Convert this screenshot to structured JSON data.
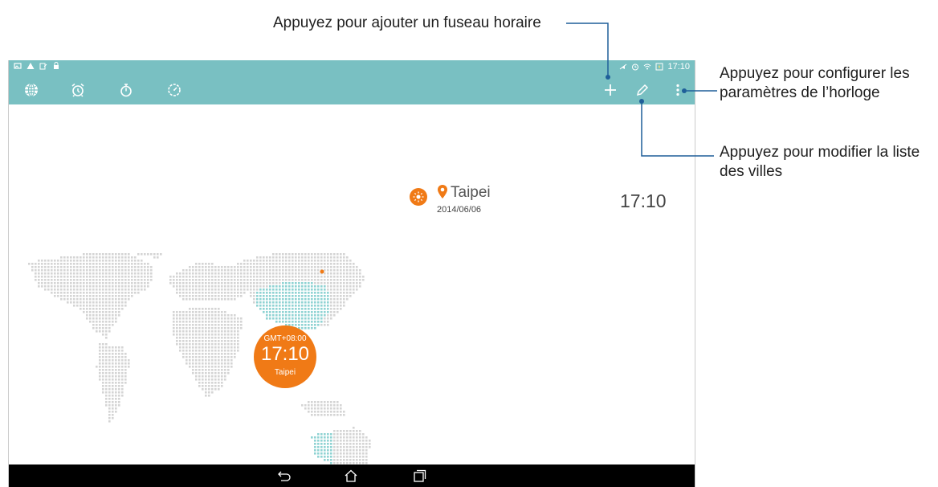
{
  "callouts": {
    "add_timezone": "Appuyez pour ajouter un fuseau horaire",
    "settings_line1": "Appuyez pour configurer les",
    "settings_line2": "paramètres de l’horloge",
    "edit_line1": "Appuyez pour modifier la liste",
    "edit_line2": "des villes"
  },
  "statusbar": {
    "time": "17:10",
    "left_icons": [
      "image-icon",
      "warning-icon",
      "signal-edit-icon",
      "lock-icon"
    ],
    "right_icons": [
      "mute-icon",
      "alarm-icon",
      "wifi-icon",
      "battery-charging-icon"
    ]
  },
  "actionbar": {
    "tabs": [
      "world-clock-icon",
      "alarm-icon",
      "stopwatch-icon",
      "timer-icon"
    ],
    "actions": [
      "add-icon",
      "edit-icon",
      "overflow-menu-icon"
    ]
  },
  "city": {
    "name": "Taipei",
    "date": "2014/06/06",
    "time": "17:10"
  },
  "map_bubble": {
    "gmt": "GMT+08:00",
    "time": "17:10",
    "city": "Taipei"
  },
  "navbar": {
    "buttons": [
      "back-icon",
      "home-icon",
      "recents-icon"
    ]
  },
  "colors": {
    "teal": "#79c0c2",
    "orange": "#f07a16",
    "map_gray": "#d4d4d4",
    "map_highlight": "#8fd3d3",
    "callout_line": "#1f5f99"
  }
}
